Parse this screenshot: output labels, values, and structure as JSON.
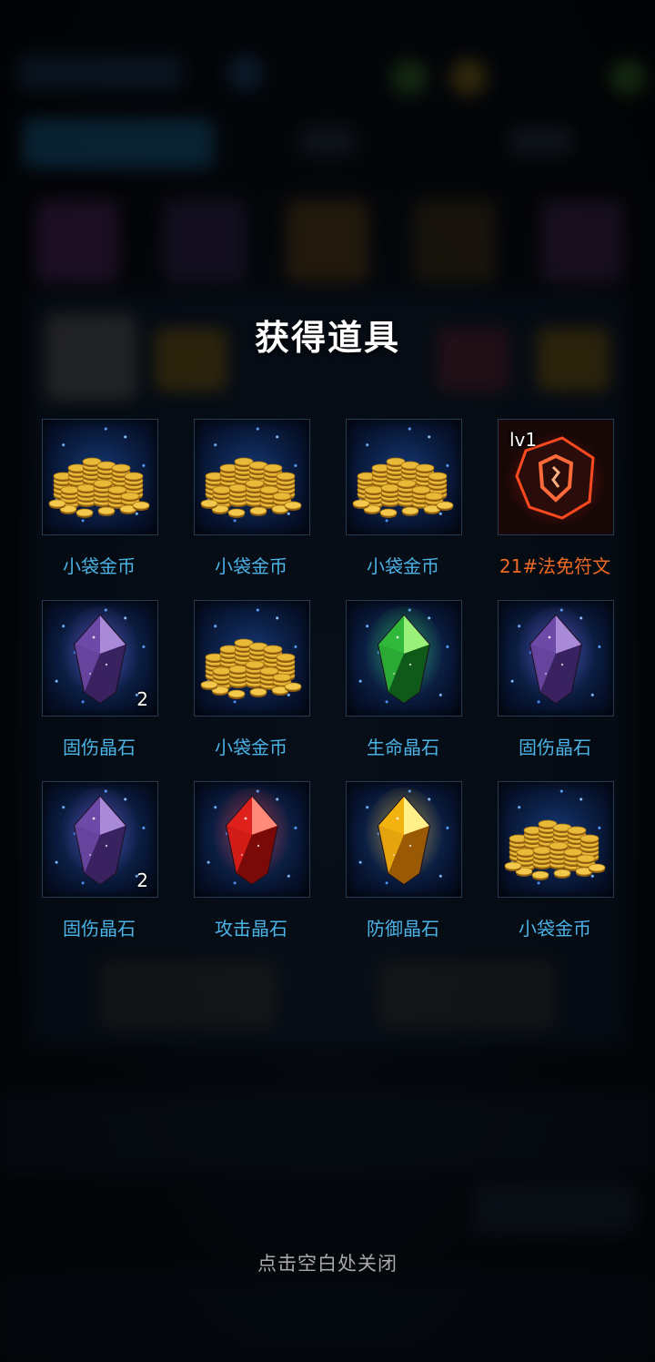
{
  "popup": {
    "title": "获得道具",
    "close_hint": "点击空白处关闭"
  },
  "items": [
    {
      "name": "小袋金币",
      "icon": "gold-coins-icon",
      "count": "",
      "level": ""
    },
    {
      "name": "小袋金币",
      "icon": "gold-coins-icon",
      "count": "",
      "level": ""
    },
    {
      "name": "小袋金币",
      "icon": "gold-coins-icon",
      "count": "",
      "level": ""
    },
    {
      "name": "21#法免符文",
      "icon": "rune-stone-icon",
      "count": "",
      "level": "lv1"
    },
    {
      "name": "固伤晶石",
      "icon": "purple-crystal-icon",
      "count": "2",
      "level": ""
    },
    {
      "name": "小袋金币",
      "icon": "gold-coins-icon",
      "count": "",
      "level": ""
    },
    {
      "name": "生命晶石",
      "icon": "green-crystal-icon",
      "count": "",
      "level": ""
    },
    {
      "name": "固伤晶石",
      "icon": "purple-crystal-icon",
      "count": "",
      "level": ""
    },
    {
      "name": "固伤晶石",
      "icon": "purple-crystal-icon",
      "count": "2",
      "level": ""
    },
    {
      "name": "攻击晶石",
      "icon": "red-crystal-icon",
      "count": "",
      "level": ""
    },
    {
      "name": "防御晶石",
      "icon": "yellow-crystal-icon",
      "count": "",
      "level": ""
    },
    {
      "name": "小袋金币",
      "icon": "gold-coins-icon",
      "count": "",
      "level": ""
    }
  ],
  "colors": {
    "item_name": "#4bb3e6",
    "rune_name": "#ee6a22",
    "title": "#ffffff",
    "hint": "#a9a9a9"
  }
}
